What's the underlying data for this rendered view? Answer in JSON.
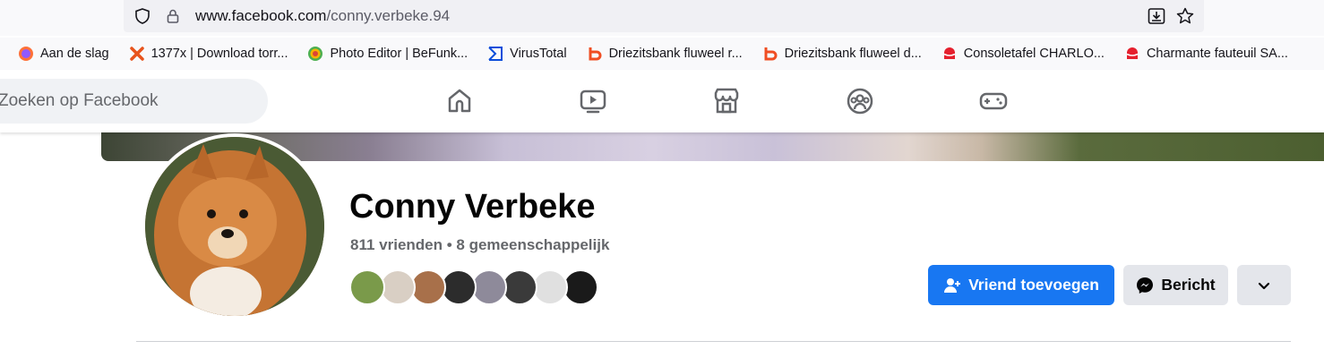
{
  "browser": {
    "url_domain": "www.facebook.com",
    "url_path": "/conny.verbeke.94",
    "bookmarks": [
      {
        "label": "Aan de slag",
        "icon": "firefox-icon"
      },
      {
        "label": "1377x | Download torr...",
        "icon": "x-icon"
      },
      {
        "label": "Photo Editor | BeFunk...",
        "icon": "befunky-icon"
      },
      {
        "label": "VirusTotal",
        "icon": "virustotal-icon"
      },
      {
        "label": "Driezitsbank fluweel r...",
        "icon": "b-icon"
      },
      {
        "label": "Driezitsbank fluweel d...",
        "icon": "b-icon"
      },
      {
        "label": "Consoletafel CHARLO...",
        "icon": "shop-icon"
      },
      {
        "label": "Charmante fauteuil SA...",
        "icon": "shop-icon"
      }
    ]
  },
  "fb_header": {
    "search_placeholder": "Zoeken op Facebook",
    "nav": [
      "home-icon",
      "watch-icon",
      "marketplace-icon",
      "groups-icon",
      "gaming-icon"
    ]
  },
  "profile": {
    "name": "Conny Verbeke",
    "friends_text": "811 vrienden • 8 gemeenschappelijk",
    "mutual_friend_colors": [
      "#7a9a4a",
      "#d9cfc4",
      "#a8704a",
      "#2c2c2c",
      "#8e8a9a",
      "#3a3a3a",
      "#e0e0e0",
      "#1a1a1a"
    ]
  },
  "actions": {
    "add_friend": "Vriend toevoegen",
    "message": "Bericht"
  },
  "colors": {
    "primary": "#1877f2",
    "secondary_button": "#e4e6eb"
  }
}
